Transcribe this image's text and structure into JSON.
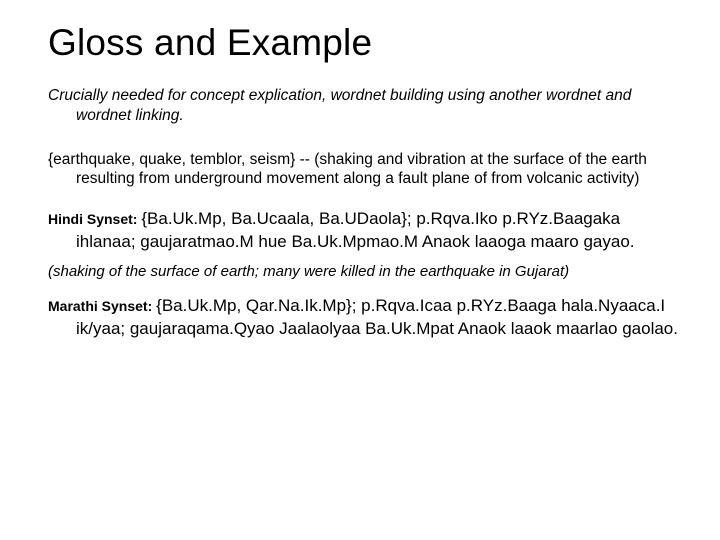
{
  "title": "Gloss and Example",
  "lead": "Crucially needed for concept explication, wordnet building using another wordnet and wordnet linking.",
  "en_example": "{earthquake, quake, temblor, seism} -- (shaking and vibration at the surface of the earth resulting from underground movement along a fault plane of from volcanic activity)",
  "hindi_label": "Hindi Synset: ",
  "hindi_synset": "{Ba.Uk.Mp, Ba.Ucaala, Ba.UDaola}; p.Rqva.Iko p.RYz.Baagaka ihlanaa; gaujaratmao.M hue Ba.Uk.Mpmao.M Anaok laaoga maaro gayao.",
  "hindi_gloss": "(shaking of the surface of earth; many were killed in the earthquake in Gujarat)",
  "marathi_label": "Marathi Synset: ",
  "marathi_synset": "{Ba.Uk.Mp, Qar.Na.Ik.Mp}; p.Rqva.Icaa p.RYz.Baaga hala.Nyaaca.I ik/yaa; gaujaraqama.Qyao Jaalaolyaa Ba.Uk.Mpat Anaok laaok maarlao gaolao."
}
